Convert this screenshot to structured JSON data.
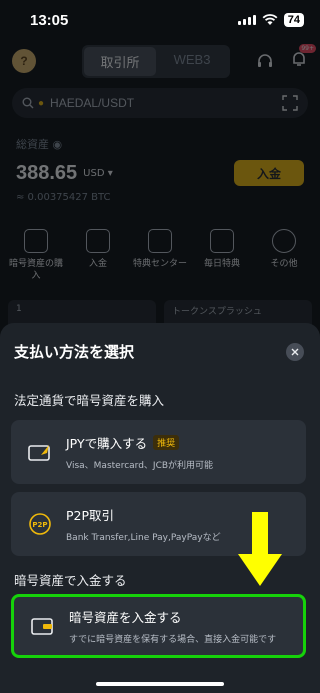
{
  "status": {
    "time": "13:05",
    "battery": "74"
  },
  "background": {
    "avatar_char": "?",
    "tabs": [
      "取引所",
      "WEB3"
    ],
    "active_tab": 0,
    "notification_badge": "99+",
    "search_placeholder": "HAEDAL/USDT",
    "assets_label": "総資産",
    "assets_amount": "388.65",
    "assets_currency": "USD ▾",
    "assets_btc": "≈ 0.00375427 BTC",
    "deposit_button": "入金",
    "shortcuts": [
      "暗号資産の購入",
      "入金",
      "特典センター",
      "毎日特典",
      "その他"
    ],
    "cards": [
      "1",
      "トークンスプラッシュ"
    ]
  },
  "sheet": {
    "title": "支払い方法を選択",
    "section_fiat": "法定通貨で暗号資産を購入",
    "section_crypto": "暗号資産で入金する",
    "options": [
      {
        "name": "JPYで購入する",
        "badge": "推奨",
        "desc": "Visa、Mastercard、JCBが利用可能"
      },
      {
        "name": "P2P取引",
        "desc": "Bank Transfer,Line Pay,PayPayなど"
      },
      {
        "name": "暗号資産を入金する",
        "desc": "すでに暗号資産を保有する場合、直接入金可能です"
      }
    ]
  },
  "colors": {
    "accent": "#f0b90b",
    "highlight": "#16d20a",
    "arrow": "#ffff00",
    "sheet_bg": "#1e2329",
    "card_bg": "#2b3139"
  }
}
